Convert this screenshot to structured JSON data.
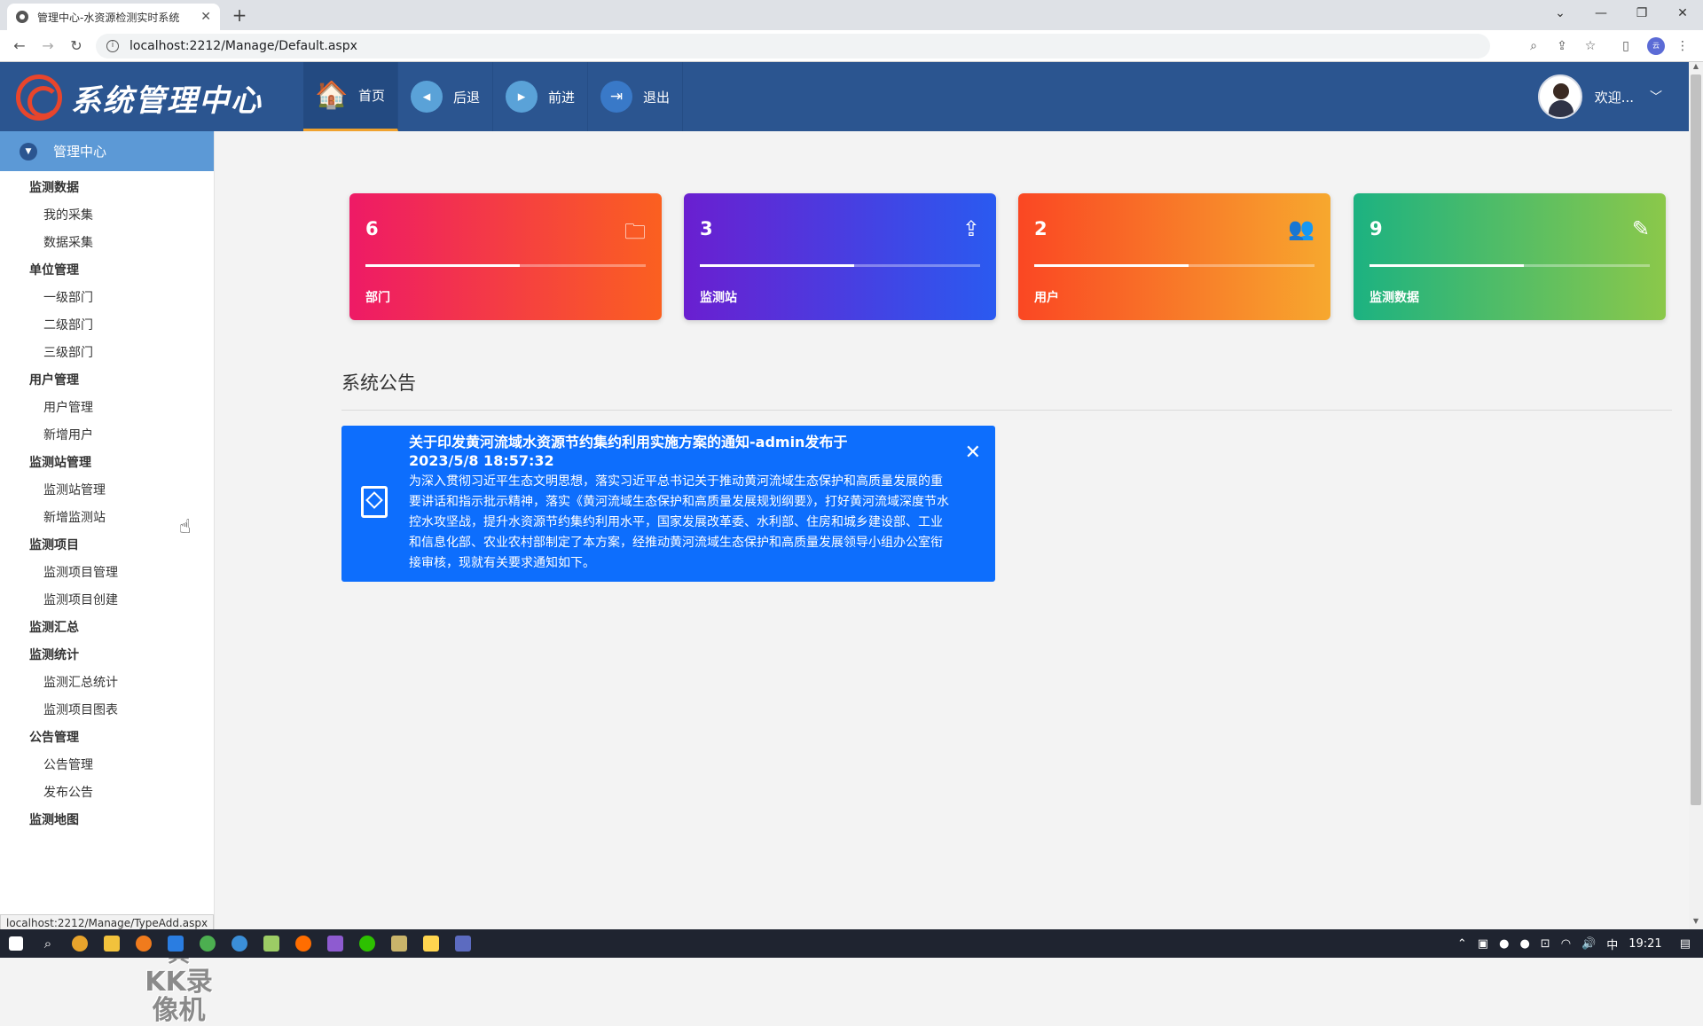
{
  "browser": {
    "tab_title": "管理中心-水资源检测实时系统",
    "url": "localhost:2212/Manage/Default.aspx",
    "status_url": "localhost:2212/Manage/TypeAdd.aspx"
  },
  "header": {
    "logo_text": "系统管理中心",
    "nav": [
      {
        "label": "首页",
        "icon": "home-icon",
        "active": true
      },
      {
        "label": "后退",
        "icon": "back-icon"
      },
      {
        "label": "前进",
        "icon": "forward-icon"
      },
      {
        "label": "退出",
        "icon": "exit-icon"
      }
    ],
    "user_label": "欢迎..."
  },
  "sidebar": {
    "title": "管理中心",
    "groups": [
      {
        "label": "监测数据",
        "items": [
          "我的采集",
          "数据采集"
        ]
      },
      {
        "label": "单位管理",
        "items": [
          "一级部门",
          "二级部门",
          "三级部门"
        ]
      },
      {
        "label": "用户管理",
        "items": [
          "用户管理",
          "新增用户"
        ]
      },
      {
        "label": "监测站管理",
        "items": [
          "监测站管理",
          "新增监测站"
        ]
      },
      {
        "label": "监测项目",
        "items": [
          "监测项目管理",
          "监测项目创建"
        ]
      },
      {
        "label": "监测汇总",
        "items": []
      },
      {
        "label": "监测统计",
        "items": [
          "监测汇总统计",
          "监测项目图表"
        ]
      },
      {
        "label": "公告管理",
        "items": [
          "公告管理",
          "发布公告"
        ]
      },
      {
        "label": "监测地图",
        "items": []
      }
    ]
  },
  "watermark": {
    "line1": "录制工具",
    "line2": "KK录像机"
  },
  "stats": [
    {
      "value": "6",
      "label": "部门",
      "icon": "folder-icon",
      "progress": 0.55
    },
    {
      "value": "3",
      "label": "监测站",
      "icon": "share-icon",
      "progress": 0.55
    },
    {
      "value": "2",
      "label": "用户",
      "icon": "users-icon",
      "progress": 0.55
    },
    {
      "value": "9",
      "label": "监测数据",
      "icon": "edit-icon",
      "progress": 0.55
    }
  ],
  "notice_section": {
    "title": "系统公告",
    "notices": [
      {
        "title": "关于印发黄河流域水资源节约集约利用实施方案的通知-admin发布于2023/5/8 18:57:32",
        "body": "为深入贯彻习近平生态文明思想，落实习近平总书记关于推动黄河流域生态保护和高质量发展的重要讲话和指示批示精神，落实《黄河流域生态保护和高质量发展规划纲要》，打好黄河流域深度节水控水攻坚战，提升水资源节约集约利用水平，国家发展改革委、水利部、住房和城乡建设部、工业和信息化部、农业农村部制定了本方案，经推动黄河流域生态保护和高质量发展领导小组办公室衔接审核，现就有关要求通知如下。"
      }
    ]
  },
  "taskbar": {
    "ime": "中",
    "time": "19:21"
  }
}
